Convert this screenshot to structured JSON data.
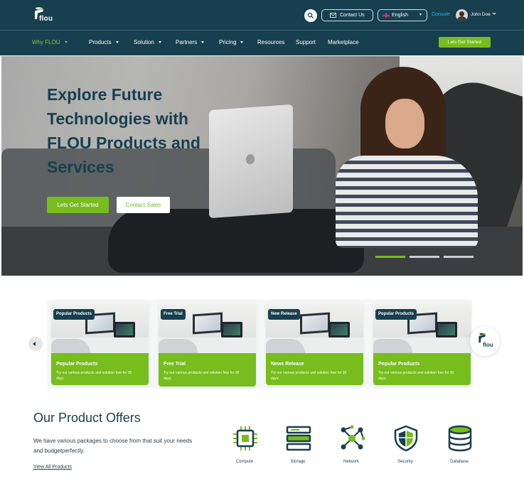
{
  "header": {
    "logo_text": "flou",
    "contact_label": "Contact Us",
    "language": "English",
    "console_label": "Console",
    "user_name": "John Doe"
  },
  "nav": {
    "items": [
      {
        "label": "Why FLOU",
        "has_dropdown": true,
        "active": true
      },
      {
        "label": "Products",
        "has_dropdown": true
      },
      {
        "label": "Solution",
        "has_dropdown": true
      },
      {
        "label": "Partners",
        "has_dropdown": true
      },
      {
        "label": "Pricing",
        "has_dropdown": true
      },
      {
        "label": "Resources",
        "has_dropdown": false
      },
      {
        "label": "Support",
        "has_dropdown": false
      },
      {
        "label": "Marketplace",
        "has_dropdown": false
      }
    ],
    "cta_label": "Lets Get Started"
  },
  "hero": {
    "title": "Explore Future Technologies with FLOU Products and Services",
    "primary_label": "Lets Get Started",
    "secondary_label": "Contact Sales",
    "slides": 3,
    "active_slide": 1
  },
  "cards": [
    {
      "badge": "Popular Products",
      "title": "Popular Products",
      "description": "Try our various products and solution free for 30 days."
    },
    {
      "badge": "Free Trial",
      "title": "Free Trial",
      "description": "Try our various products and solution free for 30 days."
    },
    {
      "badge": "New Release",
      "title": "News Release",
      "description": "Try our various products and solution free for 30 days."
    },
    {
      "badge": "Popular Products",
      "title": "Popular Products",
      "description": "Try our various products and solution free for 30 days."
    }
  ],
  "offers": {
    "title": "Our Product Offers",
    "description": "We have various packages to choose from that suit your needs and budgetperfectly.",
    "link_label": "View All Products",
    "items": [
      {
        "label": "Compute",
        "icon": "chip-icon"
      },
      {
        "label": "Storage",
        "icon": "storage-icon"
      },
      {
        "label": "Network",
        "icon": "network-icon"
      },
      {
        "label": "Security",
        "icon": "shield-icon"
      },
      {
        "label": "Database",
        "icon": "database-icon"
      }
    ]
  },
  "colors": {
    "primary_dark": "#183f4f",
    "accent_green": "#76bd1d",
    "link_blue": "#23b6e6"
  }
}
